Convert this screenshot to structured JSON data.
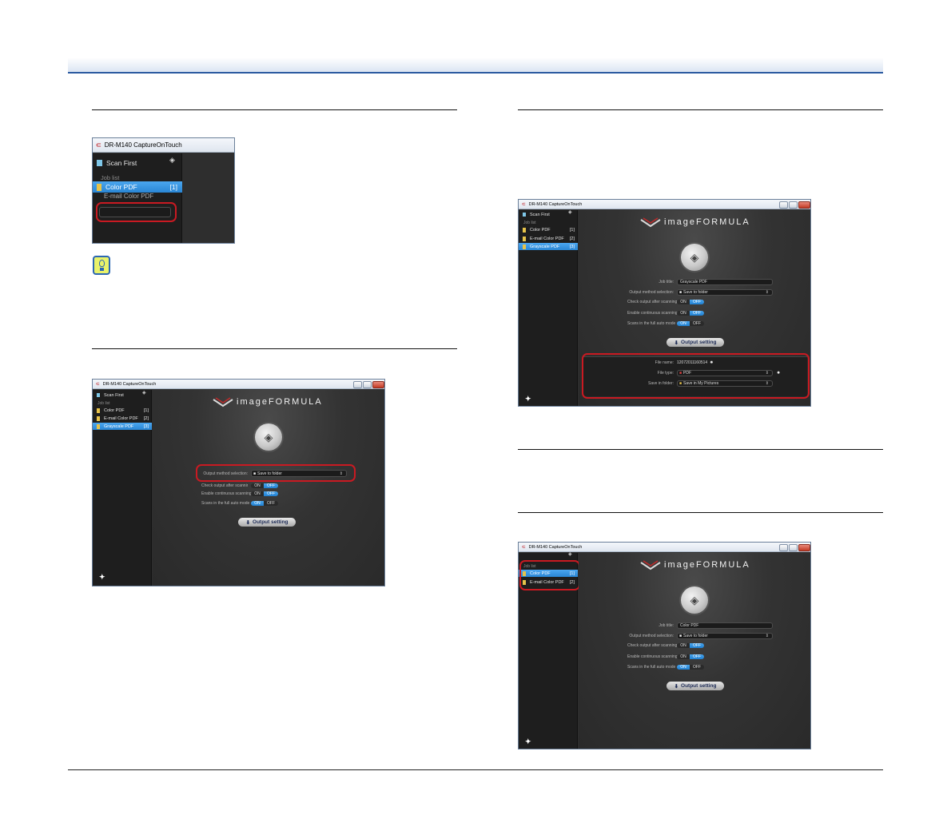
{
  "app": {
    "title": "DR-M140 CaptureOnTouch",
    "brand": "imageFORMULA",
    "scan_first": "Scan First",
    "job_list": "Job list",
    "jobs": [
      {
        "name": "Color PDF",
        "num": "[1]"
      },
      {
        "name": "E-mail Color PDF",
        "num": "[2]"
      },
      {
        "name": "Grayscale PDF",
        "num": "[3]"
      }
    ],
    "labels": {
      "job_title": "Job title:",
      "output_method": "Output method selection:",
      "check_output": "Check output after scanning",
      "continuous": "Enable continuous scanning",
      "full_auto": "Scans in the full auto mode",
      "output_setting": "Output setting",
      "file_name": "File name:",
      "file_type": "File type:",
      "save_in_folder": "Save in folder:"
    },
    "values": {
      "save_to_folder": "Save to folder",
      "title_grayscale": "Grayscale PDF",
      "title_color": "Color PDF",
      "file_name_value": "12072011160514",
      "file_type_value": "PDF",
      "folder_value": "Save in My Pictures"
    },
    "on": "ON",
    "off": "OFF"
  }
}
